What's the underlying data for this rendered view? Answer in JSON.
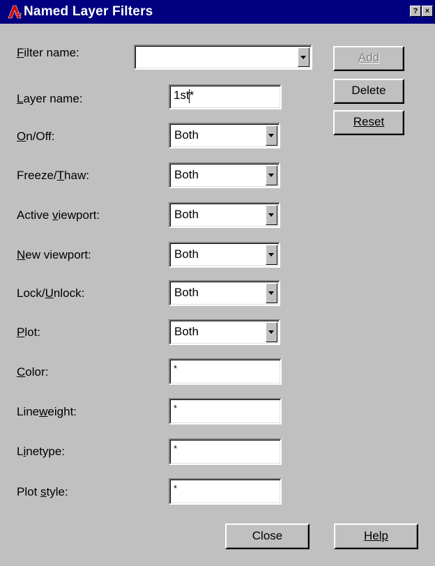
{
  "window": {
    "title": "Named Layer Filters",
    "help_glyph": "?",
    "close_glyph": "×"
  },
  "filter_name": {
    "label": "Filter name:",
    "value": ""
  },
  "layer_name": {
    "label": "Layer name:",
    "value": "1st*"
  },
  "on_off": {
    "label": "On/Off:",
    "value": "Both"
  },
  "freeze_thaw": {
    "label": "Freeze/Thaw:",
    "value": "Both"
  },
  "active_viewport": {
    "label": "Active viewport:",
    "value": "Both"
  },
  "new_viewport": {
    "label": "New viewport:",
    "value": "Both"
  },
  "lock_unlock": {
    "label": "Lock/Unlock:",
    "value": "Both"
  },
  "plot": {
    "label": "Plot:",
    "value": "Both"
  },
  "color": {
    "label": "Color:",
    "value": "*"
  },
  "lineweight": {
    "label": "Lineweight:",
    "value": "*"
  },
  "linetype": {
    "label": "Linetype:",
    "value": "*"
  },
  "plot_style": {
    "label": "Plot style:",
    "value": "*"
  },
  "buttons": {
    "add": "Add",
    "delete": "Delete",
    "reset": "Reset",
    "close": "Close",
    "help": "Help"
  },
  "colors": {
    "titlebar": "#000080",
    "face": "#c0c0c0",
    "app_icon": "#cc0000"
  },
  "icons": [
    "autocad-logo-icon",
    "help-icon",
    "close-icon",
    "chevron-down-icon"
  ]
}
